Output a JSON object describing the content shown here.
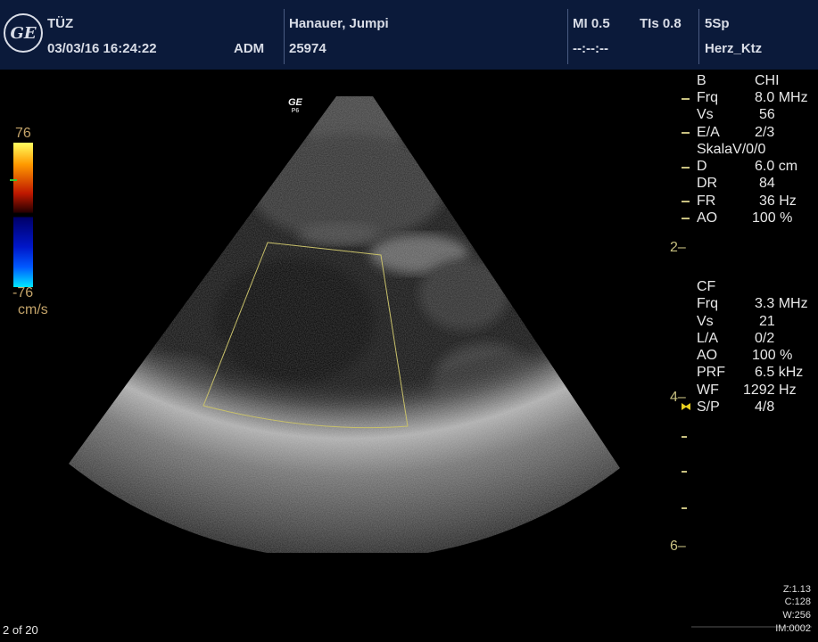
{
  "header": {
    "logo": "GE",
    "institution": "TÜZ",
    "datetime": "03/03/16 16:24:22",
    "operator": "ADM",
    "patient_name": "Hanauer, Jumpi",
    "patient_id": "25974",
    "mi": "MI 0.5",
    "tis": "TIs 0.8",
    "placeholder": "--:--:--",
    "probe": "5Sp",
    "preset": "Herz_Ktz"
  },
  "probe_mark": {
    "brand": "GE",
    "orientation": "P6"
  },
  "color_scale": {
    "max": "76",
    "min": "-76",
    "unit": "cm/s"
  },
  "params_b": [
    {
      "label": "B",
      "value": "CHI"
    },
    {
      "label": "Frq",
      "value": "8.0 MHz"
    },
    {
      "label": "Vs",
      "value": "56"
    },
    {
      "label": "E/A",
      "value": "2/3"
    },
    {
      "label": "SkalaV/0/0",
      "value": ""
    },
    {
      "label": "D",
      "value": "6.0 cm"
    },
    {
      "label": "DR",
      "value": "84"
    },
    {
      "label": "FR",
      "value": "36 Hz"
    },
    {
      "label": "AO",
      "value": "100 %"
    }
  ],
  "params_cf": [
    {
      "label": "CF",
      "value": ""
    },
    {
      "label": "Frq",
      "value": "3.3 MHz"
    },
    {
      "label": "Vs",
      "value": "21"
    },
    {
      "label": "L/A",
      "value": "0/2"
    },
    {
      "label": "AO",
      "value": "100 %"
    },
    {
      "label": "PRF",
      "value": "6.5 kHz"
    },
    {
      "label": "WF",
      "value": "1292 Hz"
    },
    {
      "label": "S/P",
      "value": "4/8"
    }
  ],
  "depth_labels": [
    "2",
    "4",
    "6"
  ],
  "zoom_info": {
    "zoom": "Z:1.13",
    "contrast": "C:128",
    "window": "W:256",
    "image": "IM:0002"
  },
  "frame_counter": "2 of 20",
  "colors": {
    "header_bg": "#0b1a3a",
    "depth_marks": "#c8c080",
    "roi_box": "#c8c06a"
  }
}
